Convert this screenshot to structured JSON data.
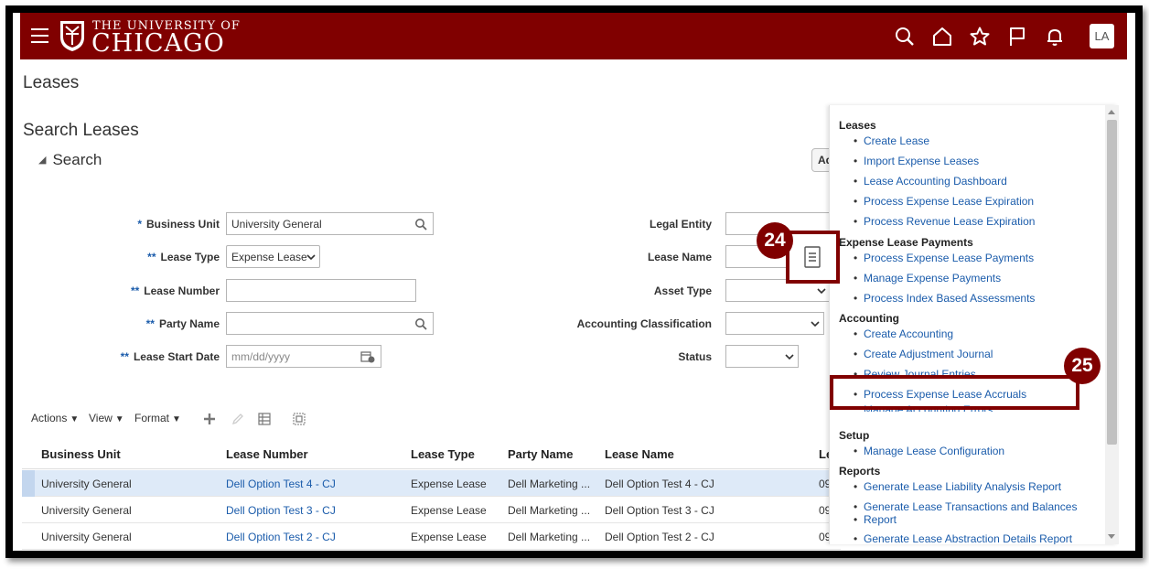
{
  "header": {
    "logo_top": "THE UNIVERSITY OF",
    "logo_main": "CHICAGO",
    "user_initials": "LA",
    "icons": [
      "menu-icon",
      "search-icon",
      "home-icon",
      "star-icon",
      "flag-icon",
      "bell-icon"
    ]
  },
  "page": {
    "title": "Leases",
    "section_title": "Search Leases",
    "search_label": "Search",
    "advanced_button": "Ad"
  },
  "form": {
    "business_unit": {
      "label": "Business Unit",
      "required": "*",
      "value": "University General"
    },
    "lease_type": {
      "label": "Lease Type",
      "required": "**",
      "value": "Expense Lease"
    },
    "lease_number": {
      "label": "Lease Number",
      "required": "**",
      "value": ""
    },
    "party_name": {
      "label": "Party Name",
      "required": "**",
      "value": ""
    },
    "lease_start_date": {
      "label": "Lease Start Date",
      "required": "**",
      "placeholder": "mm/dd/yyyy"
    },
    "legal_entity": {
      "label": "Legal Entity",
      "value": ""
    },
    "lease_name": {
      "label": "Lease Name",
      "value": ""
    },
    "asset_type": {
      "label": "Asset Type",
      "value": ""
    },
    "accounting_classification": {
      "label": "Accounting Classification",
      "value": ""
    },
    "status": {
      "label": "Status",
      "value": ""
    }
  },
  "toolbar": {
    "actions": "Actions",
    "view": "View",
    "format": "Format"
  },
  "table": {
    "columns": [
      "Business Unit",
      "Lease Number",
      "Lease Type",
      "Party Name",
      "Lease Name",
      "Le"
    ],
    "rows": [
      [
        "University General",
        "Dell Option Test 4 - CJ",
        "Expense Lease",
        "Dell Marketing ...",
        "Dell Option Test 4 - CJ",
        "09"
      ],
      [
        "University General",
        "Dell Option Test 3 - CJ",
        "Expense Lease",
        "Dell Marketing ...",
        "Dell Option Test 3 - CJ",
        "09"
      ],
      [
        "University General",
        "Dell Option Test 2 - CJ",
        "Expense Lease",
        "Dell Marketing ...",
        "Dell Option Test 2 - CJ",
        "09"
      ]
    ]
  },
  "panel": {
    "groups": [
      {
        "heading": "Leases",
        "items": [
          "Create Lease",
          "Import Expense Leases",
          "Lease Accounting Dashboard",
          "Process Expense Lease Expiration",
          "Process Revenue Lease Expiration"
        ]
      },
      {
        "heading": "Expense Lease Payments",
        "items": [
          "Process Expense Lease Payments",
          "Manage Expense Payments",
          "Process Index Based Assessments"
        ]
      },
      {
        "heading": "Accounting",
        "items": [
          "Create Accounting",
          "Create Adjustment Journal",
          "Review Journal Entries",
          "Process Expense Lease Accruals",
          "Manage Accounting Errors"
        ]
      },
      {
        "heading": "Setup",
        "items": [
          "Manage Lease Configuration"
        ]
      },
      {
        "heading": "Reports",
        "items": [
          "Generate Lease Liability Analysis Report",
          "Generate Lease Transactions and Balances",
          "Report",
          "Generate Lease Abstraction Details Report"
        ]
      }
    ]
  },
  "callouts": {
    "step_24": "24",
    "step_25": "25"
  },
  "colors": {
    "brand": "#800000",
    "link": "#1b5cab",
    "selected_row": "#deeaf8"
  }
}
